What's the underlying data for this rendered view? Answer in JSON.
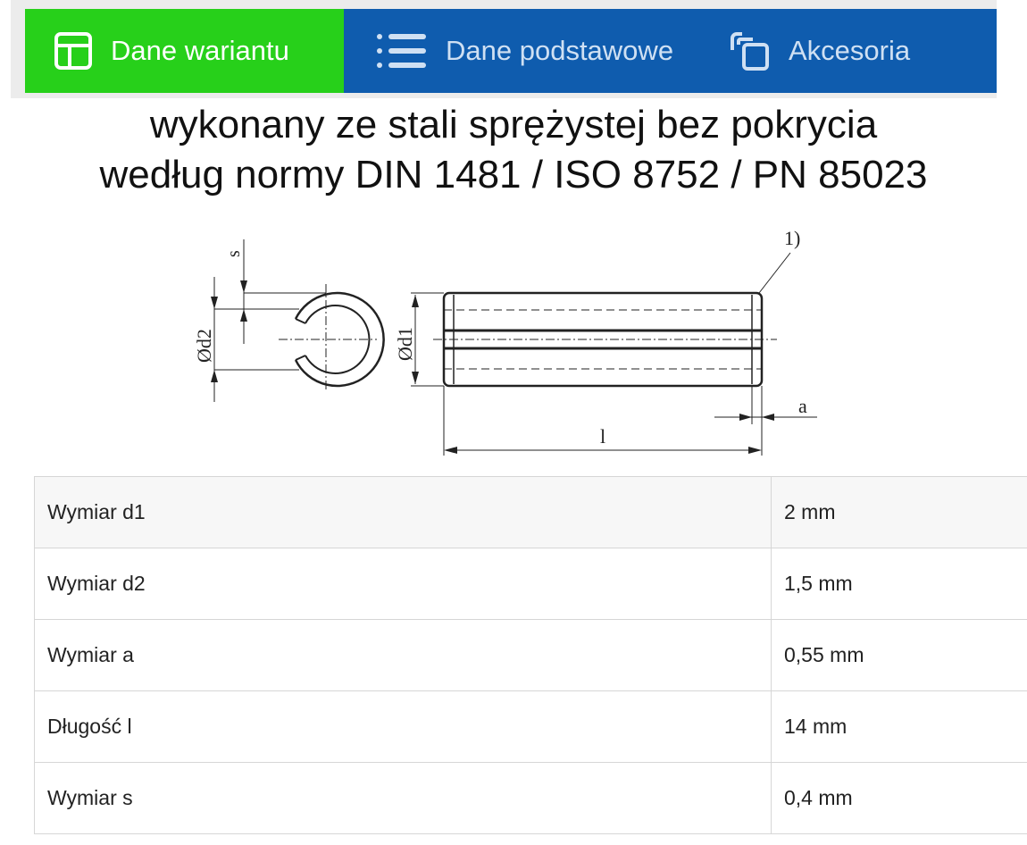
{
  "tabs": [
    {
      "label": "Dane wariantu",
      "icon": "layout-icon",
      "active": true
    },
    {
      "label": "Dane podstawowe",
      "icon": "list-icon",
      "active": false
    },
    {
      "label": "Akcesoria",
      "icon": "copy-icon",
      "active": false
    }
  ],
  "headline": {
    "line1": "wykonany ze stali sprężystej bez pokrycia",
    "line2": "według normy DIN 1481 / ISO 8752 / PN 85023"
  },
  "drawing": {
    "labels": {
      "s": "s",
      "d2": "Ød2",
      "d1": "Ød1",
      "note": "1)",
      "a": "a",
      "l": "l"
    }
  },
  "specs": [
    {
      "name": "Wymiar d1",
      "value": "2 mm"
    },
    {
      "name": "Wymiar d2",
      "value": "1,5 mm"
    },
    {
      "name": "Wymiar a",
      "value": "0,55 mm"
    },
    {
      "name": "Długość l",
      "value": "14 mm"
    },
    {
      "name": "Wymiar s",
      "value": "0,4 mm"
    }
  ],
  "colors": {
    "active_tab": "#27d01a",
    "tab_bar": "#0f5cae"
  }
}
